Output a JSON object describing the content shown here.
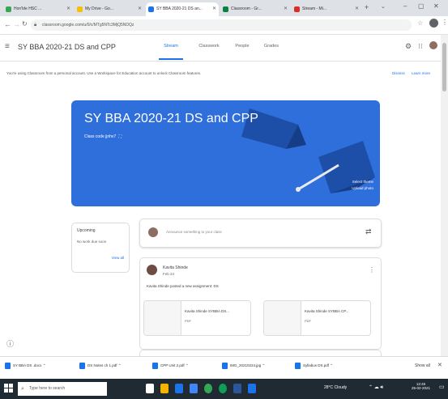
{
  "browser": {
    "tabs": [
      {
        "label": "Hon'ble HSC ...",
        "color": "#34a853"
      },
      {
        "label": "My Drive - Go...",
        "color": "#fbbc04"
      },
      {
        "label": "SY BBA 2020-21 DS an...",
        "color": "#1a73e8"
      },
      {
        "label": "Classroom - Gr...",
        "color": "#0b8043"
      },
      {
        "label": "Stream - Mi...",
        "color": "#d93025"
      }
    ],
    "address": "classroom.google.com/u/0/c/MTg5NTc3MjQ5NDQz"
  },
  "app": {
    "title": "SY BBA 2020-21 DS and CPP",
    "nav_tabs": [
      "Stream",
      "Classwork",
      "People",
      "Grades"
    ],
    "active_tab": "Stream",
    "accent": "#1a73e8"
  },
  "banner": {
    "text": "You're using Classroom from a personal account. Use a Workspace for Education account to unlock Classroom features.",
    "dismiss": "Dismiss",
    "learn_more": "Learn more"
  },
  "hero": {
    "title": "SY BBA 2020-21 DS and CPP",
    "class_code": "Class code  jjnhv7",
    "select_theme": "Select theme",
    "upload_photo": "Upload photo",
    "color": "#2f6fdc"
  },
  "upcoming": {
    "title": "Upcoming",
    "text": "No work due soon",
    "view_all": "View all"
  },
  "composer": {
    "placeholder": "Announce something to your class"
  },
  "post": {
    "author": "Kavita Shinde",
    "date": "Feb 24",
    "text": "Kavita Shinde posted a new assignment: DS",
    "attachments": [
      {
        "name": "Kavita Shinde SYBBA DS...",
        "type": "PDF"
      },
      {
        "name": "Kavita Shinde SYBBA CP...",
        "type": "PDF"
      }
    ]
  },
  "downloads": [
    {
      "label": "SY BBA DS .docx"
    },
    {
      "label": "DS Notes ch 1.pdf"
    },
    {
      "label": "CPP Unit 2.pdf"
    },
    {
      "label": "IMG_20210224.jpg"
    },
    {
      "label": "Syllabus DS.pdf"
    }
  ],
  "downloads_show_all": "Show all",
  "taskbar": {
    "search_placeholder": "Type here to search",
    "weather": "28°C Cloudy",
    "time": "12:45",
    "date": "25-02-2021",
    "icons": [
      {
        "name": "task-view-icon",
        "color": "#ffffff"
      },
      {
        "name": "explorer-icon",
        "color": "#f4b400"
      },
      {
        "name": "store-icon",
        "color": "#1a73e8"
      },
      {
        "name": "mail-icon",
        "color": "#4285f4"
      },
      {
        "name": "chrome-icon",
        "color": "#34a853"
      },
      {
        "name": "edge-icon",
        "color": "#0f9d58"
      },
      {
        "name": "word-icon",
        "color": "#2b579a"
      },
      {
        "name": "photos-icon",
        "color": "#1a73e8"
      }
    ]
  }
}
